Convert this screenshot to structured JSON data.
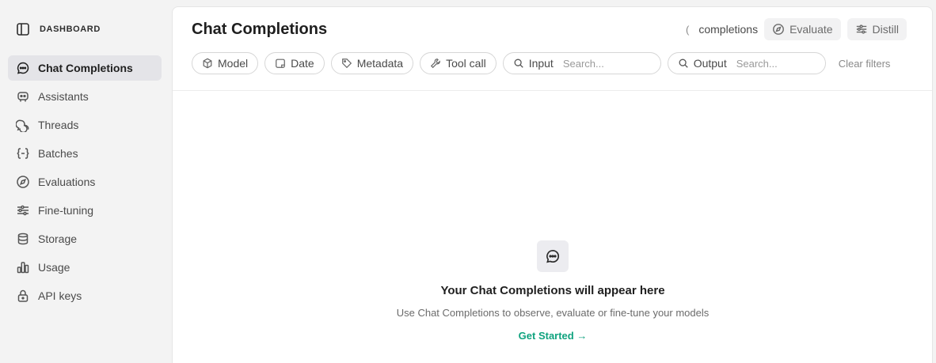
{
  "sidebar": {
    "title": "DASHBOARD",
    "items": [
      {
        "label": "Chat Completions",
        "icon": "chat-bubble-icon"
      },
      {
        "label": "Assistants",
        "icon": "robot-icon"
      },
      {
        "label": "Threads",
        "icon": "threads-icon"
      },
      {
        "label": "Batches",
        "icon": "braces-icon"
      },
      {
        "label": "Evaluations",
        "icon": "compass-icon"
      },
      {
        "label": "Fine-tuning",
        "icon": "sliders-icon"
      },
      {
        "label": "Storage",
        "icon": "database-icon"
      },
      {
        "label": "Usage",
        "icon": "bar-chart-icon"
      },
      {
        "label": "API keys",
        "icon": "lock-icon"
      }
    ]
  },
  "header": {
    "title": "Chat Completions",
    "tab_partial": "completions",
    "evaluate_label": "Evaluate",
    "distill_label": "Distill"
  },
  "filters": {
    "model": "Model",
    "date": "Date",
    "metadata": "Metadata",
    "tool_call": "Tool call",
    "input_label": "Input",
    "input_placeholder": "Search...",
    "output_label": "Output",
    "output_placeholder": "Search...",
    "clear": "Clear filters"
  },
  "empty_state": {
    "title": "Your Chat Completions will appear here",
    "subtitle": "Use Chat Completions to observe, evaluate or fine-tune your models",
    "link": "Get Started →"
  },
  "colors": {
    "accent": "#10a37f",
    "active_bg": "#e4e4e8"
  }
}
